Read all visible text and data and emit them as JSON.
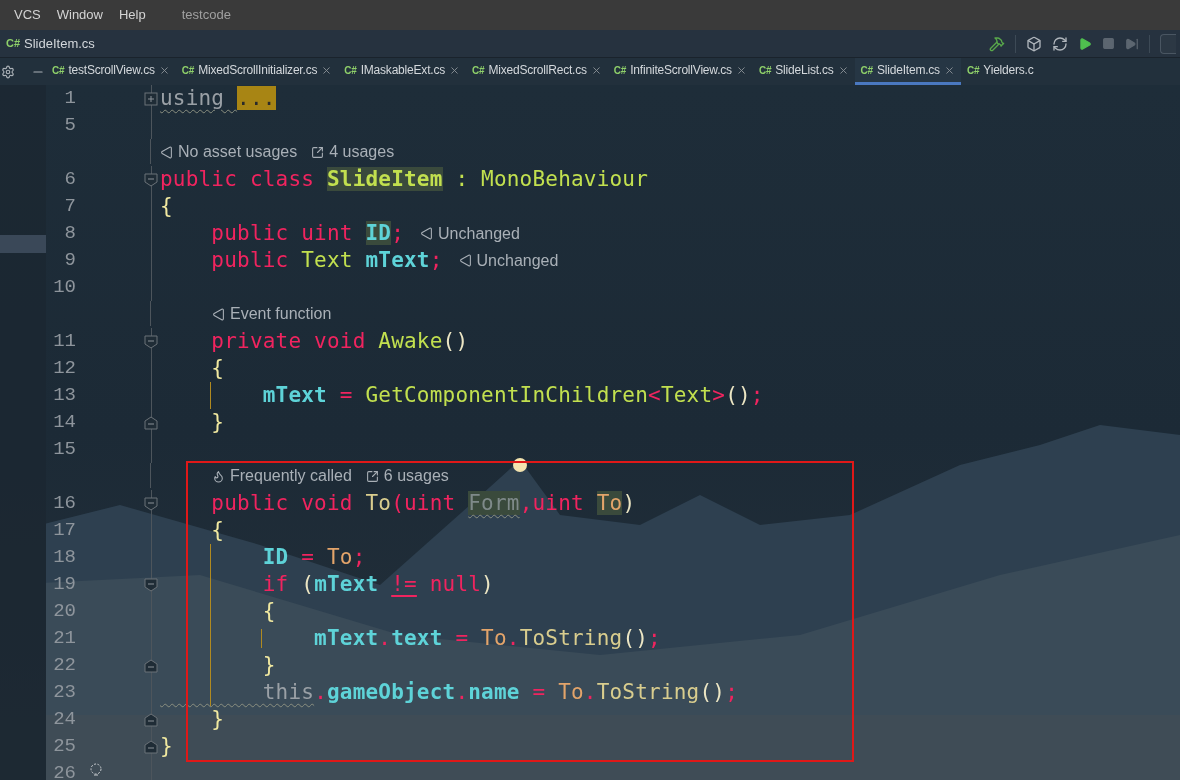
{
  "menu": {
    "items": [
      "VCS",
      "Window",
      "Help"
    ],
    "project": "testcode"
  },
  "breadcrumb": {
    "lang": "C#",
    "file": "SlideItem.cs"
  },
  "tabs": [
    {
      "lang": "C#",
      "label": "testScrollView.cs",
      "selected": false
    },
    {
      "lang": "C#",
      "label": "MixedScrollInitializer.cs",
      "selected": false
    },
    {
      "lang": "C#",
      "label": "IMaskableExt.cs",
      "selected": false
    },
    {
      "lang": "C#",
      "label": "MixedScrollRect.cs",
      "selected": false
    },
    {
      "lang": "C#",
      "label": "InfiniteScrollView.cs",
      "selected": false
    },
    {
      "lang": "C#",
      "label": "SlideList.cs",
      "selected": false
    },
    {
      "lang": "C#",
      "label": "SlideItem.cs",
      "selected": true
    },
    {
      "lang": "C#",
      "label": "Yielders.c",
      "selected": false
    }
  ],
  "lines": [
    {
      "kind": "code",
      "number": "1",
      "collapsed": true,
      "tokens": [
        {
          "text": "using ",
          "kind": "dim",
          "warning": true
        },
        {
          "text": "...",
          "kind": "folded"
        }
      ]
    },
    {
      "kind": "code",
      "number": "5"
    },
    {
      "kind": "hint",
      "items": [
        {
          "kind": "asset",
          "text": "No asset usages"
        },
        {
          "kind": "usages",
          "text": "4 usages"
        }
      ]
    },
    {
      "kind": "code",
      "number": "6",
      "block_start": true,
      "tokens": [
        {
          "text": "public class ",
          "kind": "keyword"
        },
        {
          "text": "SlideItem",
          "kind": "classname",
          "highlighted": true
        },
        {
          "text": " : MonoBehaviour",
          "kind": "type"
        }
      ]
    },
    {
      "kind": "code",
      "number": "7",
      "tokens": [
        {
          "text": "{",
          "kind": "brace"
        }
      ]
    },
    {
      "kind": "code",
      "number": "8",
      "tokens": [
        {
          "text": "    public uint ",
          "kind": "keyword"
        },
        {
          "text": "ID",
          "kind": "field",
          "highlighted": true
        },
        {
          "text": ";",
          "kind": "punct"
        }
      ],
      "hint": {
        "kind": "asset",
        "text": "Unchanged"
      }
    },
    {
      "kind": "code",
      "number": "9",
      "tokens": [
        {
          "text": "    public ",
          "kind": "keyword"
        },
        {
          "text": "Text ",
          "kind": "type"
        },
        {
          "text": "mText",
          "kind": "field"
        },
        {
          "text": ";",
          "kind": "punct"
        }
      ],
      "hint": {
        "kind": "asset",
        "text": "Unchanged"
      }
    },
    {
      "kind": "code",
      "number": "10"
    },
    {
      "kind": "hint",
      "items": [
        {
          "kind": "asset",
          "text": "Event function"
        }
      ]
    },
    {
      "kind": "code",
      "number": "11",
      "block_start": true,
      "tokens": [
        {
          "text": "    private void ",
          "kind": "keyword"
        },
        {
          "text": "Awake",
          "kind": "type"
        },
        {
          "text": "()",
          "kind": "paren"
        }
      ]
    },
    {
      "kind": "code",
      "number": "12",
      "tokens": [
        {
          "text": "    {",
          "kind": "brace"
        }
      ]
    },
    {
      "kind": "code",
      "number": "13",
      "guide": true,
      "tokens": [
        {
          "text": "        mText",
          "kind": "field"
        },
        {
          "text": " = ",
          "kind": "punct"
        },
        {
          "text": "GetComponentInChildren",
          "kind": "type"
        },
        {
          "text": "<",
          "kind": "punct"
        },
        {
          "text": "Text",
          "kind": "type"
        },
        {
          "text": ">",
          "kind": "punct"
        },
        {
          "text": "()",
          "kind": "paren"
        },
        {
          "text": ";",
          "kind": "punct"
        }
      ]
    },
    {
      "kind": "code",
      "number": "14",
      "block_end": true,
      "tokens": [
        {
          "text": "    }",
          "kind": "brace"
        }
      ]
    },
    {
      "kind": "code",
      "number": "15"
    },
    {
      "kind": "hint",
      "items": [
        {
          "kind": "frequency",
          "text": "Frequently called"
        },
        {
          "kind": "usages",
          "text": "6 usages"
        }
      ]
    },
    {
      "kind": "code",
      "number": "16",
      "block_start": true,
      "tokens": [
        {
          "text": "    public void ",
          "kind": "keyword"
        },
        {
          "text": "To",
          "kind": "method"
        },
        {
          "text": "(uint ",
          "kind": "keyword"
        },
        {
          "text": "Form",
          "kind": "unused",
          "highlighted": true,
          "warning": true
        },
        {
          "text": ",uint ",
          "kind": "keyword"
        },
        {
          "text": "To",
          "kind": "local",
          "highlighted": true
        },
        {
          "text": ")",
          "kind": "paren"
        }
      ]
    },
    {
      "kind": "code",
      "number": "17",
      "tokens": [
        {
          "text": "    {",
          "kind": "brace"
        }
      ]
    },
    {
      "kind": "code",
      "number": "18",
      "guide": true,
      "tokens": [
        {
          "text": "        ID",
          "kind": "field"
        },
        {
          "text": " = ",
          "kind": "punct"
        },
        {
          "text": "To",
          "kind": "local"
        },
        {
          "text": ";",
          "kind": "punct"
        }
      ]
    },
    {
      "kind": "code",
      "number": "19",
      "block_start": true,
      "guide": true,
      "tokens": [
        {
          "text": "        if ",
          "kind": "keyword"
        },
        {
          "text": "(",
          "kind": "paren"
        },
        {
          "text": "mText ",
          "kind": "field"
        },
        {
          "text": "!=",
          "kind": "punct",
          "warning": true
        },
        {
          "text": " null",
          "kind": "keyword"
        },
        {
          "text": ")",
          "kind": "paren"
        }
      ]
    },
    {
      "kind": "code",
      "number": "20",
      "guide": true,
      "tokens": [
        {
          "text": "        {",
          "kind": "brace"
        }
      ]
    },
    {
      "kind": "code",
      "number": "21",
      "guide": true,
      "inner_guide": true,
      "tokens": [
        {
          "text": "            mText",
          "kind": "field"
        },
        {
          "text": ".",
          "kind": "punct"
        },
        {
          "text": "text",
          "kind": "field"
        },
        {
          "text": " = ",
          "kind": "punct"
        },
        {
          "text": "To",
          "kind": "local"
        },
        {
          "text": ".",
          "kind": "punct"
        },
        {
          "text": "ToString",
          "kind": "call"
        },
        {
          "text": "()",
          "kind": "paren"
        },
        {
          "text": ";",
          "kind": "punct"
        }
      ]
    },
    {
      "kind": "code",
      "number": "22",
      "block_end": true,
      "guide": true,
      "tokens": [
        {
          "text": "        }",
          "kind": "brace"
        }
      ]
    },
    {
      "kind": "code",
      "number": "23",
      "guide": true,
      "tokens": [
        {
          "text": "        this",
          "kind": "dim",
          "warning": true
        },
        {
          "text": ".",
          "kind": "punct"
        },
        {
          "text": "gameObject",
          "kind": "field"
        },
        {
          "text": ".",
          "kind": "punct"
        },
        {
          "text": "name",
          "kind": "field"
        },
        {
          "text": " = ",
          "kind": "punct"
        },
        {
          "text": "To",
          "kind": "local"
        },
        {
          "text": ".",
          "kind": "punct"
        },
        {
          "text": "ToString",
          "kind": "call"
        },
        {
          "text": "()",
          "kind": "paren"
        },
        {
          "text": ";",
          "kind": "punct"
        }
      ]
    },
    {
      "kind": "code",
      "number": "24",
      "block_end": true,
      "tokens": [
        {
          "text": "    }",
          "kind": "brace"
        }
      ]
    },
    {
      "kind": "code",
      "number": "25",
      "block_end": true,
      "tokens": [
        {
          "text": "}",
          "kind": "brace"
        }
      ]
    },
    {
      "kind": "code",
      "number": "26",
      "bulb": true
    }
  ]
}
